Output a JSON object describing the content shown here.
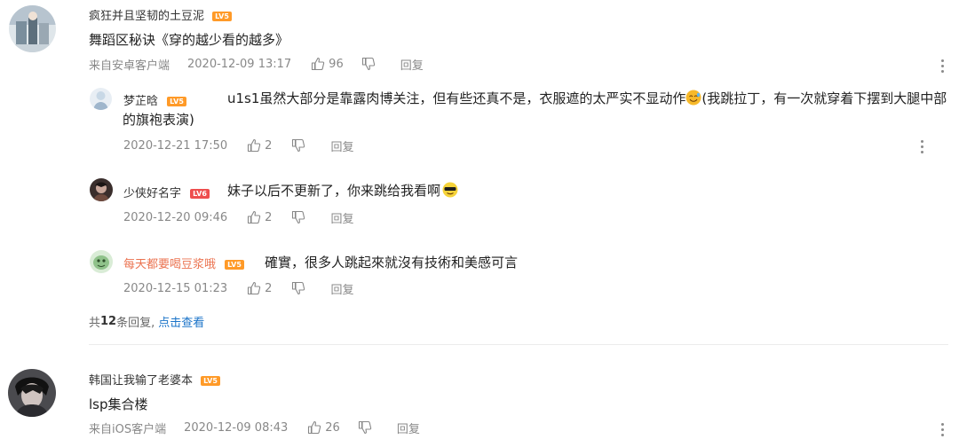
{
  "comments": [
    {
      "username": "疯狂并且坚韧的土豆泥",
      "level": "LV5",
      "text": "舞蹈区秘诀《穿的越少看的越多》",
      "source": "来自安卓客户端",
      "time": "2020-12-09 13:17",
      "likes": "96",
      "reply_label": "回复",
      "replies": [
        {
          "username": "梦芷晗",
          "level": "LV5",
          "text_part1": "u1s1虽然大部分是靠露肉博关注，但有些还真不是，衣服遮的太严实不显动作",
          "text_part2": "(我跳拉丁，有一次就穿着下摆到大腿中部的旗袍表演)",
          "time": "2020-12-21 17:50",
          "likes": "2",
          "reply_label": "回复"
        },
        {
          "username": "少侠好名字",
          "level": "LV6",
          "text": "妹子以后不更新了，你来跳给我看啊",
          "time": "2020-12-20 09:46",
          "likes": "2",
          "reply_label": "回复"
        },
        {
          "username": "每天都要喝豆浆哦",
          "level": "LV5",
          "text": "確實，很多人跳起來就沒有技術和美感可言",
          "time": "2020-12-15 01:23",
          "likes": "2",
          "reply_label": "回复"
        }
      ],
      "more_replies_prefix": "共",
      "more_replies_count": "12",
      "more_replies_suffix": "条回复,",
      "more_replies_link": "点击查看"
    },
    {
      "username": "韩国让我输了老婆本",
      "level": "LV5",
      "text": "lsp集合楼",
      "source": "来自iOS客户端",
      "time": "2020-12-09 08:43",
      "likes": "26",
      "reply_label": "回复"
    }
  ],
  "colors": {
    "level_orange": "#ff9a28",
    "level_red": "#ee4e4e",
    "link_blue": "#1a73c8",
    "vip_name": "#eb7350",
    "meta_gray": "#888888"
  },
  "icons": [
    "thumbs-up-icon",
    "thumbs-down-icon",
    "more-vertical-icon",
    "smile-emoji-icon",
    "sunglasses-emoji-icon"
  ]
}
